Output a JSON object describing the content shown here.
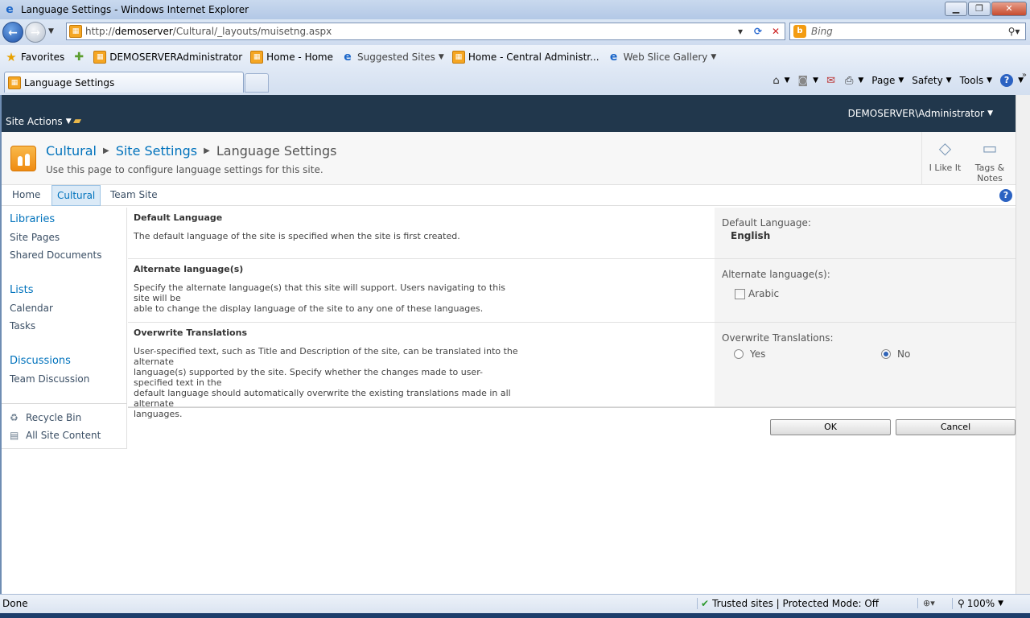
{
  "window": {
    "title": "Language Settings - Windows Internet Explorer",
    "minimize_icon": "minimize-icon",
    "restore_icon": "restore-icon",
    "close_icon": "close-icon"
  },
  "address_bar": {
    "url_prefix": "http://",
    "url_host": "demoserver",
    "url_path": "/Cultural/_layouts/muisetng.aspx",
    "search_placeholder": "Bing"
  },
  "favorites_bar": {
    "favorites_label": "Favorites",
    "items": [
      {
        "label": "DEMOSERVERAdministrator"
      },
      {
        "label": "Home - Home"
      },
      {
        "label": "Suggested Sites"
      },
      {
        "label": "Home - Central Administr..."
      },
      {
        "label": "Web Slice Gallery"
      }
    ]
  },
  "tabs": {
    "active_tab_label": "Language Settings"
  },
  "command_bar": {
    "page": "Page",
    "safety": "Safety",
    "tools": "Tools"
  },
  "sharepoint": {
    "site_actions": "Site Actions",
    "user": "DEMOSERVER\\Administrator",
    "breadcrumb": {
      "site": "Cultural",
      "settings": "Site Settings",
      "current": "Language Settings"
    },
    "page_description": "Use this page to configure language settings for this site.",
    "social": {
      "like": "I Like It",
      "tags_line1": "Tags &",
      "tags_line2": "Notes"
    },
    "top_nav": [
      "Home",
      "Cultural",
      "Team Site"
    ],
    "top_nav_selected": "Cultural",
    "quick_launch": {
      "libraries": "Libraries",
      "site_pages": "Site Pages",
      "shared_documents": "Shared Documents",
      "lists": "Lists",
      "calendar": "Calendar",
      "tasks": "Tasks",
      "discussions": "Discussions",
      "team_discussion": "Team Discussion",
      "recycle_bin": "Recycle Bin",
      "all_site_content": "All Site Content"
    },
    "sections": {
      "default_language": {
        "title": "Default Language",
        "description": "The default language of the site is specified when the site is first created.",
        "field_label": "Default Language:",
        "value": "English"
      },
      "alternate_languages": {
        "title": "Alternate language(s)",
        "description_line1": "Specify the alternate language(s) that this site will support. Users navigating to this site will be",
        "description_line2": "able to change the display language of the site to any one of these languages.",
        "field_label": "Alternate language(s):",
        "option": "Arabic",
        "option_checked": false
      },
      "overwrite_translations": {
        "title": "Overwrite Translations",
        "description_line1": "User-specified text, such as Title and Description of the site, can be translated into the alternate",
        "description_line2": "language(s) supported by the site. Specify whether the changes made to user-specified text in the",
        "description_line3": "default language should automatically overwrite the existing translations made in all alternate",
        "description_line4": "languages.",
        "field_label": "Overwrite Translations:",
        "yes": "Yes",
        "no": "No",
        "selected": "No"
      }
    },
    "buttons": {
      "ok": "OK",
      "cancel": "Cancel"
    }
  },
  "status_bar": {
    "status": "Done",
    "zone": "Trusted sites | Protected Mode: Off",
    "zoom": "100%"
  }
}
